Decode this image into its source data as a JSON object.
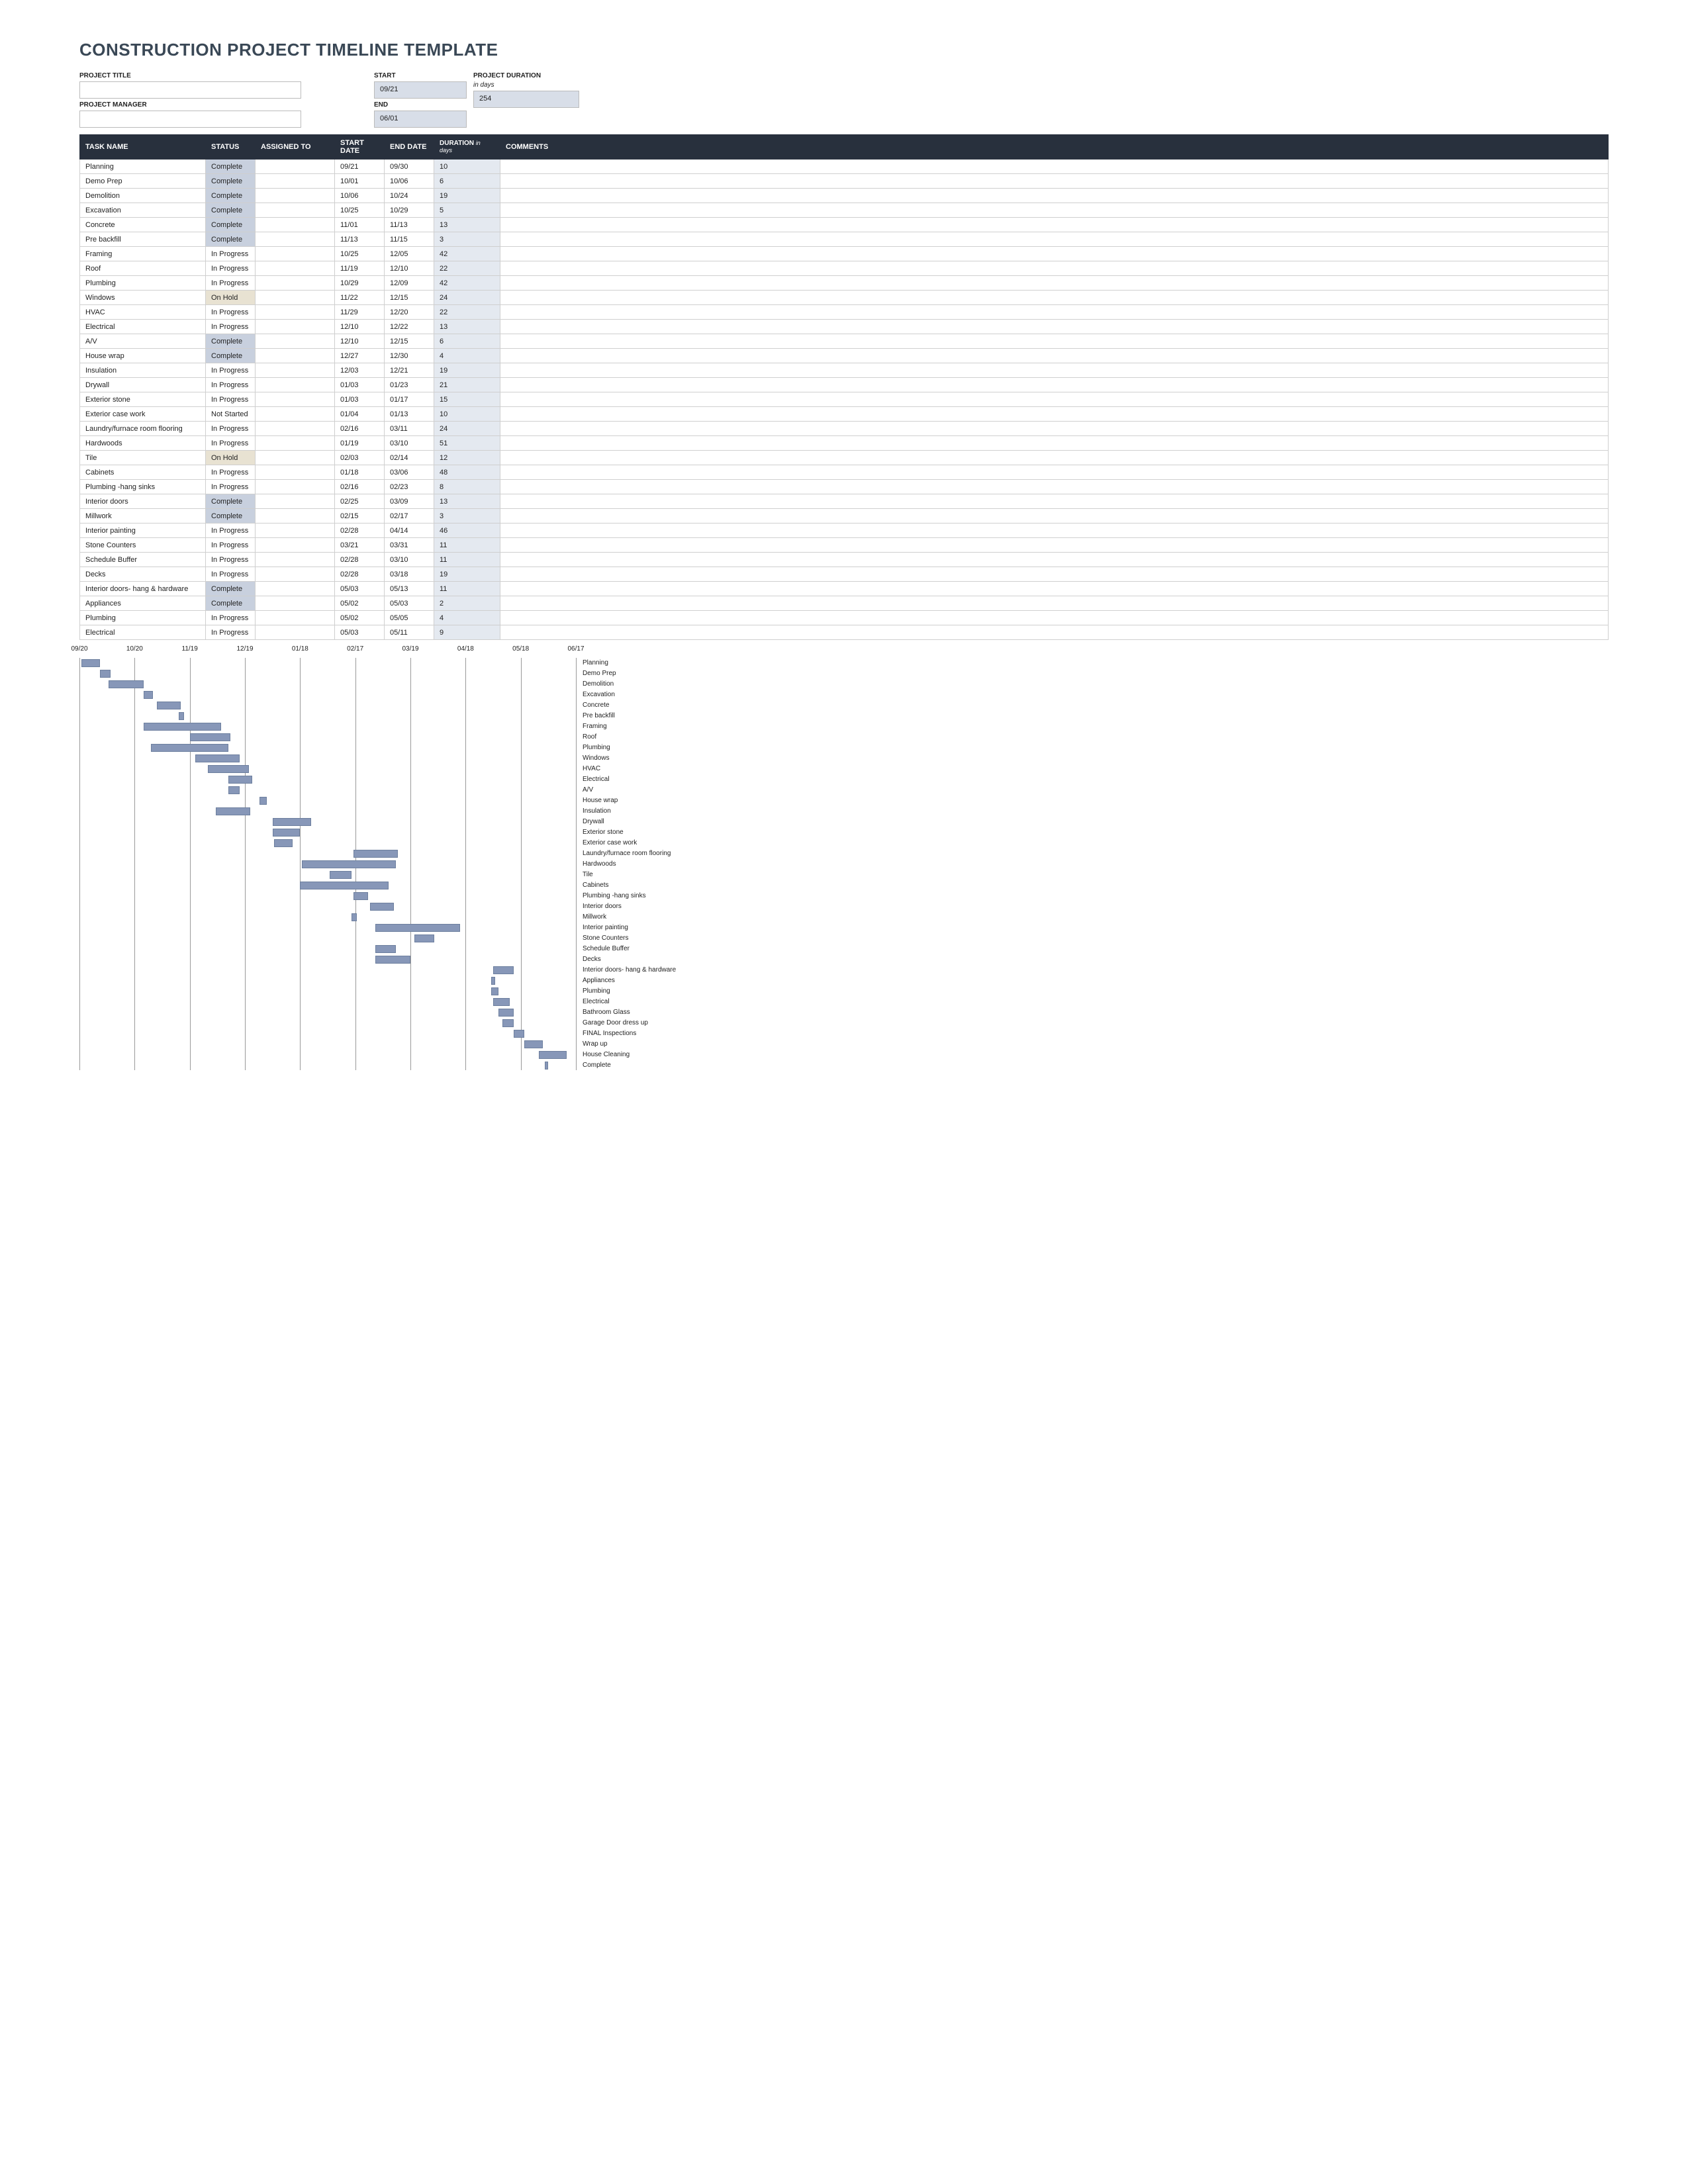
{
  "title": "CONSTRUCTION PROJECT TIMELINE TEMPLATE",
  "meta": {
    "project_title_label": "PROJECT TITLE",
    "project_title": "",
    "project_manager_label": "PROJECT MANAGER",
    "project_manager": "",
    "start_label": "START",
    "start": "09/21",
    "end_label": "END",
    "end": "06/01",
    "duration_label": "PROJECT DURATION",
    "duration_sub": "in days",
    "duration": "254"
  },
  "columns": {
    "name": "TASK NAME",
    "status": "STATUS",
    "assigned": "ASSIGNED TO",
    "start": "START DATE",
    "end": "END DATE",
    "dur": "DURATION",
    "dur_sub": "in days",
    "comments": "COMMENTS"
  },
  "tasks": [
    {
      "name": "Planning",
      "status": "Complete",
      "assigned": "",
      "start": "09/21",
      "end": "09/30",
      "dur": "10",
      "comments": ""
    },
    {
      "name": "Demo Prep",
      "status": "Complete",
      "assigned": "",
      "start": "10/01",
      "end": "10/06",
      "dur": "6",
      "comments": ""
    },
    {
      "name": "Demolition",
      "status": "Complete",
      "assigned": "",
      "start": "10/06",
      "end": "10/24",
      "dur": "19",
      "comments": ""
    },
    {
      "name": "Excavation",
      "status": "Complete",
      "assigned": "",
      "start": "10/25",
      "end": "10/29",
      "dur": "5",
      "comments": ""
    },
    {
      "name": "Concrete",
      "status": "Complete",
      "assigned": "",
      "start": "11/01",
      "end": "11/13",
      "dur": "13",
      "comments": ""
    },
    {
      "name": "Pre backfill",
      "status": "Complete",
      "assigned": "",
      "start": "11/13",
      "end": "11/15",
      "dur": "3",
      "comments": ""
    },
    {
      "name": "Framing",
      "status": "In Progress",
      "assigned": "",
      "start": "10/25",
      "end": "12/05",
      "dur": "42",
      "comments": ""
    },
    {
      "name": "Roof",
      "status": "In Progress",
      "assigned": "",
      "start": "11/19",
      "end": "12/10",
      "dur": "22",
      "comments": ""
    },
    {
      "name": "Plumbing",
      "status": "In Progress",
      "assigned": "",
      "start": "10/29",
      "end": "12/09",
      "dur": "42",
      "comments": ""
    },
    {
      "name": "Windows",
      "status": "On Hold",
      "assigned": "",
      "start": "11/22",
      "end": "12/15",
      "dur": "24",
      "comments": ""
    },
    {
      "name": "HVAC",
      "status": "In Progress",
      "assigned": "",
      "start": "11/29",
      "end": "12/20",
      "dur": "22",
      "comments": ""
    },
    {
      "name": "Electrical",
      "status": "In Progress",
      "assigned": "",
      "start": "12/10",
      "end": "12/22",
      "dur": "13",
      "comments": ""
    },
    {
      "name": "A/V",
      "status": "Complete",
      "assigned": "",
      "start": "12/10",
      "end": "12/15",
      "dur": "6",
      "comments": ""
    },
    {
      "name": "House wrap",
      "status": "Complete",
      "assigned": "",
      "start": "12/27",
      "end": "12/30",
      "dur": "4",
      "comments": ""
    },
    {
      "name": "Insulation",
      "status": "In Progress",
      "assigned": "",
      "start": "12/03",
      "end": "12/21",
      "dur": "19",
      "comments": ""
    },
    {
      "name": "Drywall",
      "status": "In Progress",
      "assigned": "",
      "start": "01/03",
      "end": "01/23",
      "dur": "21",
      "comments": ""
    },
    {
      "name": "Exterior stone",
      "status": "In Progress",
      "assigned": "",
      "start": "01/03",
      "end": "01/17",
      "dur": "15",
      "comments": ""
    },
    {
      "name": "Exterior case work",
      "status": "Not Started",
      "assigned": "",
      "start": "01/04",
      "end": "01/13",
      "dur": "10",
      "comments": ""
    },
    {
      "name": "Laundry/furnace room flooring",
      "status": "In Progress",
      "assigned": "",
      "start": "02/16",
      "end": "03/11",
      "dur": "24",
      "comments": ""
    },
    {
      "name": "Hardwoods",
      "status": "In Progress",
      "assigned": "",
      "start": "01/19",
      "end": "03/10",
      "dur": "51",
      "comments": ""
    },
    {
      "name": "Tile",
      "status": "On Hold",
      "assigned": "",
      "start": "02/03",
      "end": "02/14",
      "dur": "12",
      "comments": ""
    },
    {
      "name": "Cabinets",
      "status": "In Progress",
      "assigned": "",
      "start": "01/18",
      "end": "03/06",
      "dur": "48",
      "comments": ""
    },
    {
      "name": "Plumbing -hang sinks",
      "status": "In Progress",
      "assigned": "",
      "start": "02/16",
      "end": "02/23",
      "dur": "8",
      "comments": ""
    },
    {
      "name": "Interior doors",
      "status": "Complete",
      "assigned": "",
      "start": "02/25",
      "end": "03/09",
      "dur": "13",
      "comments": ""
    },
    {
      "name": "Millwork",
      "status": "Complete",
      "assigned": "",
      "start": "02/15",
      "end": "02/17",
      "dur": "3",
      "comments": ""
    },
    {
      "name": "Interior painting",
      "status": "In Progress",
      "assigned": "",
      "start": "02/28",
      "end": "04/14",
      "dur": "46",
      "comments": ""
    },
    {
      "name": "Stone Counters",
      "status": "In Progress",
      "assigned": "",
      "start": "03/21",
      "end": "03/31",
      "dur": "11",
      "comments": ""
    },
    {
      "name": "Schedule Buffer",
      "status": "In Progress",
      "assigned": "",
      "start": "02/28",
      "end": "03/10",
      "dur": "11",
      "comments": ""
    },
    {
      "name": "Decks",
      "status": "In Progress",
      "assigned": "",
      "start": "02/28",
      "end": "03/18",
      "dur": "19",
      "comments": ""
    },
    {
      "name": "Interior doors- hang & hardware",
      "status": "Complete",
      "assigned": "",
      "start": "05/03",
      "end": "05/13",
      "dur": "11",
      "comments": ""
    },
    {
      "name": "Appliances",
      "status": "Complete",
      "assigned": "",
      "start": "05/02",
      "end": "05/03",
      "dur": "2",
      "comments": ""
    },
    {
      "name": "Plumbing",
      "status": "In Progress",
      "assigned": "",
      "start": "05/02",
      "end": "05/05",
      "dur": "4",
      "comments": ""
    },
    {
      "name": "Electrical",
      "status": "In Progress",
      "assigned": "",
      "start": "05/03",
      "end": "05/11",
      "dur": "9",
      "comments": ""
    }
  ],
  "chart_data": {
    "type": "bar",
    "orientation": "horizontal",
    "xlabel": "",
    "ylabel": "",
    "title": "",
    "x_ticks": [
      "09/20",
      "10/20",
      "11/19",
      "12/19",
      "01/18",
      "02/17",
      "03/19",
      "04/18",
      "05/18",
      "06/17"
    ],
    "x_range_days": [
      0,
      270
    ],
    "series": [
      {
        "name": "Planning",
        "start_day": 1,
        "duration": 10
      },
      {
        "name": "Demo Prep",
        "start_day": 11,
        "duration": 6
      },
      {
        "name": "Demolition",
        "start_day": 16,
        "duration": 19
      },
      {
        "name": "Excavation",
        "start_day": 35,
        "duration": 5
      },
      {
        "name": "Concrete",
        "start_day": 42,
        "duration": 13
      },
      {
        "name": "Pre backfill",
        "start_day": 54,
        "duration": 3
      },
      {
        "name": "Framing",
        "start_day": 35,
        "duration": 42
      },
      {
        "name": "Roof",
        "start_day": 60,
        "duration": 22
      },
      {
        "name": "Plumbing",
        "start_day": 39,
        "duration": 42
      },
      {
        "name": "Windows",
        "start_day": 63,
        "duration": 24
      },
      {
        "name": "HVAC",
        "start_day": 70,
        "duration": 22
      },
      {
        "name": "Electrical",
        "start_day": 81,
        "duration": 13
      },
      {
        "name": "A/V",
        "start_day": 81,
        "duration": 6
      },
      {
        "name": "House wrap",
        "start_day": 98,
        "duration": 4
      },
      {
        "name": "Insulation",
        "start_day": 74,
        "duration": 19
      },
      {
        "name": "Drywall",
        "start_day": 105,
        "duration": 21
      },
      {
        "name": "Exterior stone",
        "start_day": 105,
        "duration": 15
      },
      {
        "name": "Exterior case work",
        "start_day": 106,
        "duration": 10
      },
      {
        "name": "Laundry/furnace room flooring",
        "start_day": 149,
        "duration": 24
      },
      {
        "name": "Hardwoods",
        "start_day": 121,
        "duration": 51
      },
      {
        "name": "Tile",
        "start_day": 136,
        "duration": 12
      },
      {
        "name": "Cabinets",
        "start_day": 120,
        "duration": 48
      },
      {
        "name": "Plumbing -hang sinks",
        "start_day": 149,
        "duration": 8
      },
      {
        "name": "Interior doors",
        "start_day": 158,
        "duration": 13
      },
      {
        "name": "Millwork",
        "start_day": 148,
        "duration": 3
      },
      {
        "name": "Interior painting",
        "start_day": 161,
        "duration": 46
      },
      {
        "name": "Stone Counters",
        "start_day": 182,
        "duration": 11
      },
      {
        "name": "Schedule Buffer",
        "start_day": 161,
        "duration": 11
      },
      {
        "name": "Decks",
        "start_day": 161,
        "duration": 19
      },
      {
        "name": "Interior doors- hang & hardware",
        "start_day": 225,
        "duration": 11
      },
      {
        "name": "Appliances",
        "start_day": 224,
        "duration": 2
      },
      {
        "name": "Plumbing",
        "start_day": 224,
        "duration": 4
      },
      {
        "name": "Electrical",
        "start_day": 225,
        "duration": 9
      },
      {
        "name": "Bathroom Glass",
        "start_day": 228,
        "duration": 8
      },
      {
        "name": "Garage Door dress up",
        "start_day": 230,
        "duration": 6
      },
      {
        "name": "FINAL Inspections",
        "start_day": 236,
        "duration": 6
      },
      {
        "name": "Wrap up",
        "start_day": 242,
        "duration": 10
      },
      {
        "name": "House Cleaning",
        "start_day": 250,
        "duration": 15
      },
      {
        "name": "Complete",
        "start_day": 253,
        "duration": 2
      }
    ]
  }
}
